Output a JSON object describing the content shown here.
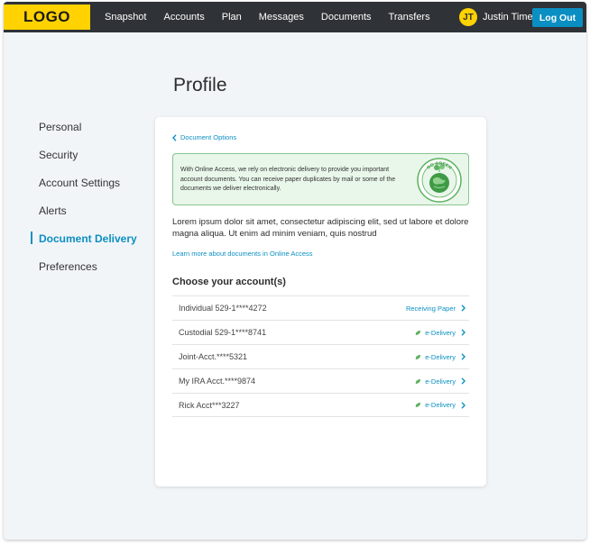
{
  "header": {
    "logo": "LOGO",
    "nav": [
      "Snapshot",
      "Accounts",
      "Plan",
      "Messages",
      "Documents",
      "Transfers"
    ],
    "user_initials": "JT",
    "user_name": "Justin Time",
    "logout_label": "Log Out"
  },
  "page": {
    "title": "Profile"
  },
  "sidebar": {
    "items": [
      {
        "label": "Personal",
        "active": false
      },
      {
        "label": "Security",
        "active": false
      },
      {
        "label": "Account Settings",
        "active": false
      },
      {
        "label": "Alerts",
        "active": false
      },
      {
        "label": "Document Delivery",
        "active": true
      },
      {
        "label": "Preferences",
        "active": false
      }
    ]
  },
  "card": {
    "back_link": "Document Options",
    "banner_text": "With Online Access, we rely on electronic delivery to provide you important account documents. You can receive paper duplicates by mail or some of the documents we deliver electronically.",
    "badge_text": "GO GREEN",
    "intro": "Lorem ipsum dolor sit amet, consectetur adipiscing elit, sed  ut labore et dolore magna aliqua. Ut enim ad minim veniam, quis nostrud",
    "learn_link": "Learn more about documents in Online Access",
    "section_title": "Choose your account(s)",
    "accounts": [
      {
        "name": "Individual 529-1****4272",
        "status": "Receiving Paper",
        "edelivery": false
      },
      {
        "name": "Custodial 529-1****8741",
        "status": "e-Delivery",
        "edelivery": true
      },
      {
        "name": "Joint-Acct.****5321",
        "status": "e-Delivery",
        "edelivery": true
      },
      {
        "name": "My IRA Acct.****9874",
        "status": "e-Delivery",
        "edelivery": true
      },
      {
        "name": "Rick Acct***3227",
        "status": "e-Delivery",
        "edelivery": true
      }
    ]
  },
  "colors": {
    "accent": "#0b8fc2",
    "brand_yellow": "#ffd200",
    "nav_bg": "#2f3236",
    "eco_green": "#5cb25f"
  }
}
